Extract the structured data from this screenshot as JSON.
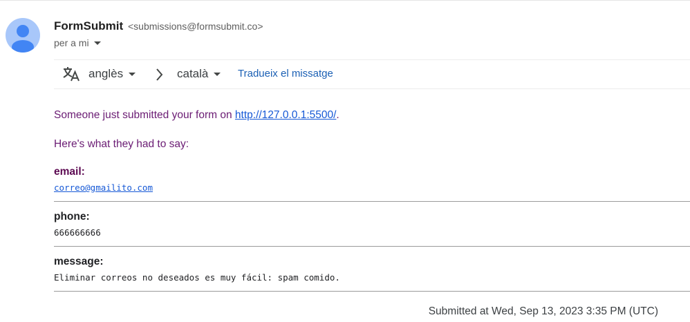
{
  "header": {
    "sender_name": "FormSubmit",
    "sender_email": "<submissions@formsubmit.co>",
    "recipient_label": "per a mi",
    "avatar_icon": "person-avatar-icon"
  },
  "translate_bar": {
    "source_language": "anglès",
    "target_language": "català",
    "translate_link": "Tradueix el missatge",
    "translate_icon": "translate-icon"
  },
  "message": {
    "intro_prefix": "Someone just submitted your form on ",
    "intro_link": "http://127.0.0.1:5500/",
    "intro_suffix": ".",
    "subintro": "Here's what they had to say:",
    "fields": [
      {
        "label": "email:",
        "value": "correo@gmailito.com"
      },
      {
        "label": "phone:",
        "value": "666666666"
      },
      {
        "label": "message:",
        "value": "Eliminar correos no deseados es muy fácil: spam comido."
      }
    ],
    "submitted": "Submitted at Wed, Sep 13, 2023 3:35 PM (UTC)"
  },
  "colors": {
    "avatar_bg": "#a8c7fa",
    "avatar_fg": "#4285f4",
    "link": "#1558d6",
    "text_purple": "#6a1b73"
  }
}
